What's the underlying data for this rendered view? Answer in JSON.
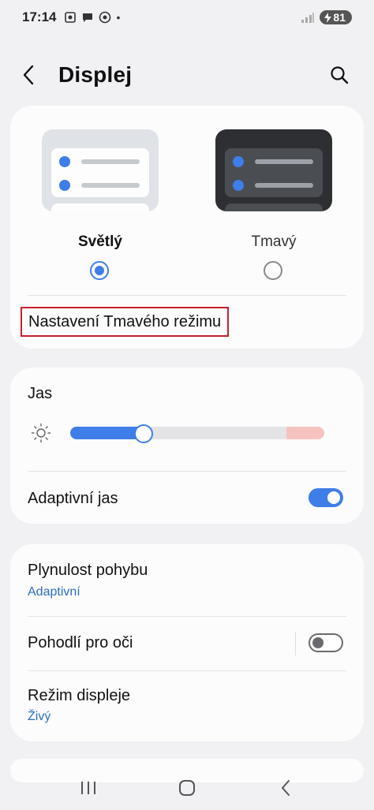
{
  "status_bar": {
    "time": "17:14",
    "battery": "81",
    "notification_icons": [
      "screenshot-icon",
      "chat-icon",
      "app-icon"
    ],
    "dot": "•"
  },
  "header": {
    "title": "Displej",
    "back_icon": "back-arrow-icon",
    "search_icon": "search-icon"
  },
  "theme": {
    "light_label": "Světlý",
    "dark_label": "Tmavý",
    "selected": "light",
    "dark_settings_label": "Nastavení Tmavého režimu"
  },
  "brightness": {
    "label": "Jas",
    "level": 0.29,
    "adaptive_label": "Adaptivní jas",
    "adaptive_enabled": true
  },
  "more": {
    "motion_label": "Plynulost pohybu",
    "motion_value": "Adaptivní",
    "eye_comfort_label": "Pohodlí pro oči",
    "eye_comfort_enabled": false,
    "screen_mode_label": "Režim displeje",
    "screen_mode_value": "Živý"
  },
  "colors": {
    "accent": "#3f7de8",
    "highlight_box": "#c8202a",
    "subtext": "#2f6dc4"
  }
}
